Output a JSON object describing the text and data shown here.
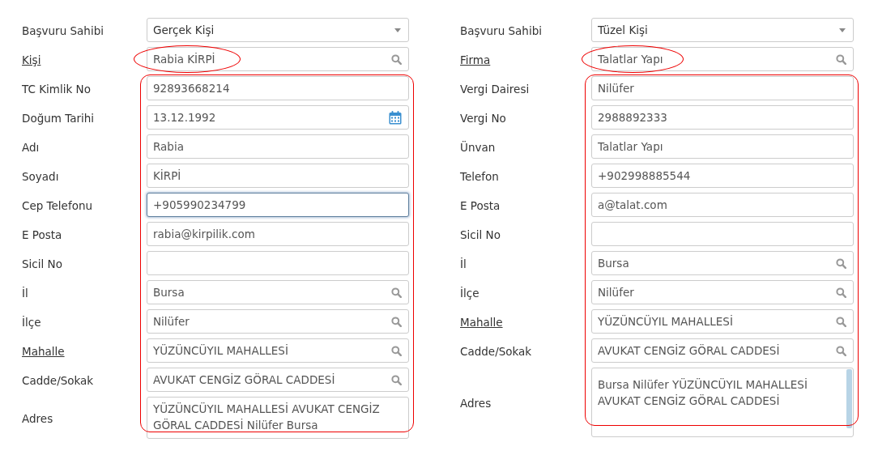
{
  "forms": [
    {
      "rows": [
        {
          "label": "Başvuru Sahibi",
          "kind": "select",
          "value": "Gerçek Kişi",
          "link": false,
          "circled": false,
          "focused": false
        },
        {
          "label": "Kişi",
          "kind": "search",
          "value": "Rabia KİRPİ",
          "link": true,
          "circled": true,
          "focused": false
        }
      ],
      "highlighted_group": {
        "rows": [
          {
            "label": "TC Kimlik No",
            "kind": "text",
            "value": "92893668214",
            "link": false,
            "focused": false
          },
          {
            "label": "Doğum Tarihi",
            "kind": "date",
            "value": "13.12.1992",
            "link": false,
            "focused": false
          },
          {
            "label": "Adı",
            "kind": "text",
            "value": "Rabia",
            "link": false,
            "focused": false
          },
          {
            "label": "Soyadı",
            "kind": "text",
            "value": "KİRPİ",
            "link": false,
            "focused": false
          },
          {
            "label": "Cep Telefonu",
            "kind": "text",
            "value": "+905990234799",
            "link": false,
            "focused": true
          },
          {
            "label": "E Posta",
            "kind": "text",
            "value": "rabia@kirpilik.com",
            "link": false,
            "focused": false
          },
          {
            "label": "Sicil No",
            "kind": "text",
            "link": false,
            "focused": false
          },
          {
            "label": "İl",
            "kind": "search",
            "value": "Bursa",
            "link": false,
            "focused": false
          },
          {
            "label": "İlçe",
            "kind": "search",
            "value": "Nilüfer",
            "link": false,
            "focused": false
          },
          {
            "label": "Mahalle",
            "kind": "search",
            "value": "YÜZÜNCÜYIL MAHALLESİ",
            "link": true,
            "focused": false
          },
          {
            "label": "Cadde/Sokak",
            "kind": "search",
            "value": "AVUKAT CENGİZ GÖRAL CADDESİ",
            "link": false,
            "focused": false
          },
          {
            "label": "Adres",
            "kind": "textarea",
            "value": "YÜZÜNCÜYIL MAHALLESİ AVUKAT CENGİZ GÖRAL CADDESİ Nilüfer Bursa",
            "link": false,
            "focused": false
          }
        ]
      }
    },
    {
      "rows": [
        {
          "label": "Başvuru Sahibi",
          "kind": "select",
          "value": "Tüzel Kişi",
          "link": false,
          "circled": false,
          "focused": false
        },
        {
          "label": "Firma",
          "kind": "search",
          "value": "Talatlar Yapı",
          "link": true,
          "circled": true,
          "focused": false
        }
      ],
      "highlighted_group": {
        "rows": [
          {
            "label": "Vergi Dairesi",
            "kind": "text",
            "value": "Nilüfer",
            "link": false,
            "focused": false
          },
          {
            "label": "Vergi No",
            "kind": "text",
            "value": "2988892333",
            "link": false,
            "focused": false
          },
          {
            "label": "Ünvan",
            "kind": "text",
            "value": "Talatlar Yapı",
            "link": false,
            "focused": false
          },
          {
            "label": "Telefon",
            "kind": "text",
            "value": "+902998885544",
            "link": false,
            "focused": false
          },
          {
            "label": "E Posta",
            "kind": "text",
            "value": "a@talat.com",
            "link": false,
            "focused": false
          },
          {
            "label": "Sicil No",
            "kind": "text",
            "link": false,
            "focused": false
          },
          {
            "label": "İl",
            "kind": "search",
            "value": "Bursa",
            "link": false,
            "focused": false
          },
          {
            "label": "İlçe",
            "kind": "search",
            "value": "Nilüfer",
            "link": false,
            "focused": false
          },
          {
            "label": "Mahalle",
            "kind": "search",
            "value": "YÜZÜNCÜYIL MAHALLESİ",
            "link": true,
            "focused": false
          },
          {
            "label": "Cadde/Sokak",
            "kind": "search",
            "value": "AVUKAT CENGİZ GÖRAL CADDESİ",
            "link": false,
            "focused": false
          },
          {
            "label": "Adres",
            "kind": "textarea",
            "value": "Bursa Nilüfer YÜZÜNCÜYIL MAHALLESİ AVUKAT CENGİZ GÖRAL CADDESİ",
            "link": false,
            "focused": false
          }
        ]
      }
    }
  ]
}
